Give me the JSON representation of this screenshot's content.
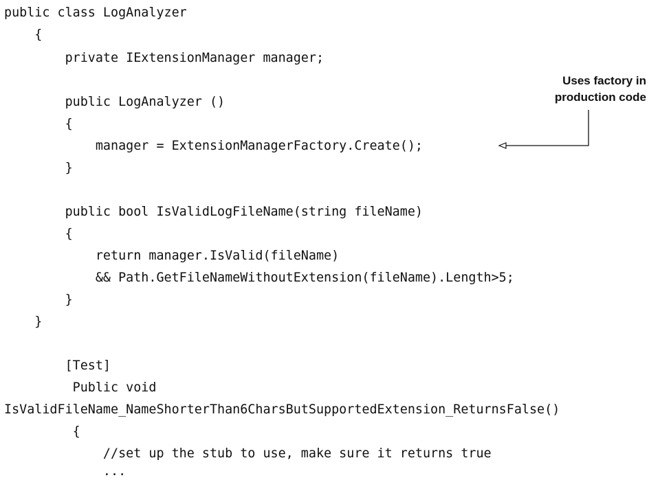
{
  "code_lines": [
    "public class LogAnalyzer",
    "    {",
    "        private IExtensionManager manager;",
    "",
    "        public LogAnalyzer ()",
    "        {",
    "            manager = ExtensionManagerFactory.Create();",
    "        }",
    "",
    "        public bool IsValidLogFileName(string fileName)",
    "        {",
    "            return manager.IsValid(fileName)",
    "            && Path.GetFileNameWithoutExtension(fileName).Length>5;",
    "        }",
    "    }",
    "",
    "        [Test]",
    "         Public void",
    "IsValidFileName_NameShorterThan6CharsButSupportedExtension_ReturnsFalse()",
    "         {",
    "             //set up the stub to use, make sure it returns true",
    "             ..."
  ],
  "annotation": {
    "line1": "Uses factory  in",
    "line2": "production code"
  }
}
